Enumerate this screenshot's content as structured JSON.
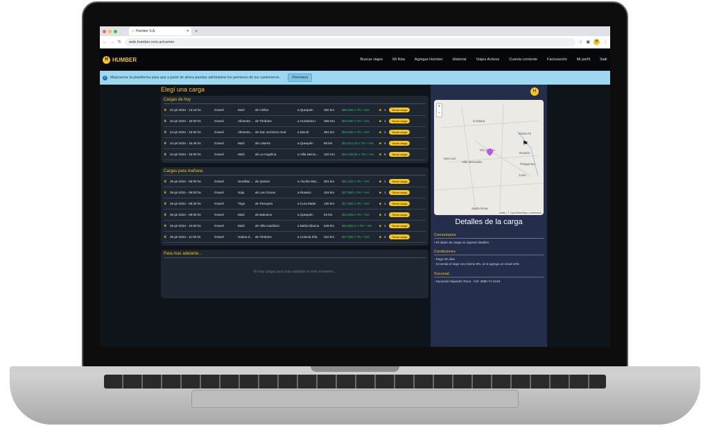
{
  "browser": {
    "tab_title": "Humber S.A.",
    "url": "web.humber.com.ar/carrier",
    "profile_initial": "H"
  },
  "header": {
    "brand": "HUMBER",
    "nav": [
      "Buscar viajes",
      "Mi flota",
      "Agregar Humber",
      "Historial",
      "Viajes Activos",
      "Cuenta corriente",
      "Facturación",
      "Mi perfil",
      "Salir"
    ]
  },
  "banner": {
    "message": "Mejoramos la plataforma para que a partir de ahora puedas administrar los permisos de tus camioneros..",
    "button": "Permisos"
  },
  "loads": {
    "title": "Elegí una carga",
    "take_label": "Tomar carga",
    "sections": [
      {
        "title": "Cargas de hoy",
        "rows": [
          {
            "date": "24-jul-2024 - 13:18 hs",
            "type": "Granel",
            "product": "Maíz",
            "from": "de Chillar",
            "to": "a Quequén",
            "km": "200 km",
            "price": "$25.000 x TN + IVA",
            "qty": "1"
          },
          {
            "date": "24-jul-2024 - 15:00 hs",
            "type": "Granel",
            "product": "Alimento...",
            "from": "de Timbúes",
            "to": "a Humberto I",
            "km": "255 Km",
            "price": "$18.000 x TN + IVA",
            "qty": "1"
          },
          {
            "date": "24-jul-2024 - 15:00 hs",
            "type": "Granel",
            "product": "Alimento...",
            "from": "de San Jerónimo Sud",
            "to": "a Morull",
            "km": "381 km",
            "price": "$18.000 x TN + IVA",
            "qty": "1"
          },
          {
            "date": "24-jul-2024 - 15:46 hs",
            "type": "Granel",
            "product": "Maíz",
            "from": "de Lobería",
            "to": "a Quequén",
            "km": "88 km",
            "price": "$12.211,33 x TN + IVA",
            "qty": "4"
          },
          {
            "date": "24-jul-2024 - 18:00 hs",
            "type": "Granel",
            "product": "Maíz",
            "from": "de La Angelina",
            "to": "a Villa Merce...",
            "km": "102 Km",
            "price": "$16.400,51 x TN + IVA",
            "qty": "9"
          }
        ]
      },
      {
        "title": "Cargas para mañana",
        "rows": [
          {
            "date": "25-jul-2024 - 08:00 hs",
            "type": "Granel",
            "product": "Semillas ...",
            "from": "de Quines",
            "to": "a Vicuña Mac...",
            "km": "301 km",
            "price": "$21.102 x TN + IVA",
            "qty": "1"
          },
          {
            "date": "25-jul-2024 - 08:00 hs",
            "type": "Granel",
            "product": "Soja",
            "from": "de Los Cisnes",
            "to": "a Rosario",
            "km": "316 km",
            "price": "$27.900 x TN + IVA",
            "qty": "1"
          },
          {
            "date": "25-jul-2024 - 08:30 hs",
            "type": "Granel",
            "product": "Trigo",
            "from": "de Tornquist",
            "to": "a Cura Malal",
            "km": "130 km",
            "price": "$17.000 x TN + IVA",
            "qty": "1"
          },
          {
            "date": "25-jul-2024 - 09:00 hs",
            "type": "Granel",
            "product": "Maíz",
            "from": "de Balcarce",
            "to": "a Quequén",
            "km": "94 km",
            "price": "$12.605 x TN + IVA",
            "qty": "3"
          },
          {
            "date": "25-jul-2024 - 10:00 hs",
            "type": "Granel",
            "product": "Maíz",
            "from": "de Villa Huidobro",
            "to": "a Bahía Blanca",
            "km": "549 km",
            "price": "$34.802,2 x TN + IVA",
            "qty": "1"
          },
          {
            "date": "25-jul-2024 - 11:00 hs",
            "type": "Granel",
            "product": "Harina d...",
            "from": "de Timbúes",
            "to": "a Colonia Elía",
            "km": "310 km",
            "price": "$17.000 x TN + IVA",
            "qty": "2"
          }
        ]
      }
    ],
    "later": {
      "title": "Para mas adelante...",
      "empty": "No hay cargas para mas adelante en este momento..."
    }
  },
  "detail": {
    "badge": "H",
    "map": {
      "labels": [
        "Córdoba",
        "Santa Fe",
        "Río Cuarto",
        "San Luis",
        "Villa Mercedes",
        "Rosario",
        "Pergamino",
        "Junín",
        "Santa Rosa"
      ],
      "attribution": "Leaflet | © OpenStreetMap contributors"
    },
    "title": "Detalles de la carga",
    "comments_title": "Comentarios",
    "comments": [
      "• El dador de carga no ingresó detalles"
    ],
    "conditions_title": "Condiciones",
    "conditions": [
      "- Pago 30 días",
      "- Si tomás el viaje vos mismo 8%, si te agrega un zonal 10%"
    ],
    "branch_title": "Sucursal",
    "branch": [
      "- Sucursal Alejandro Roca - Cel: 3585-71-3146"
    ]
  }
}
